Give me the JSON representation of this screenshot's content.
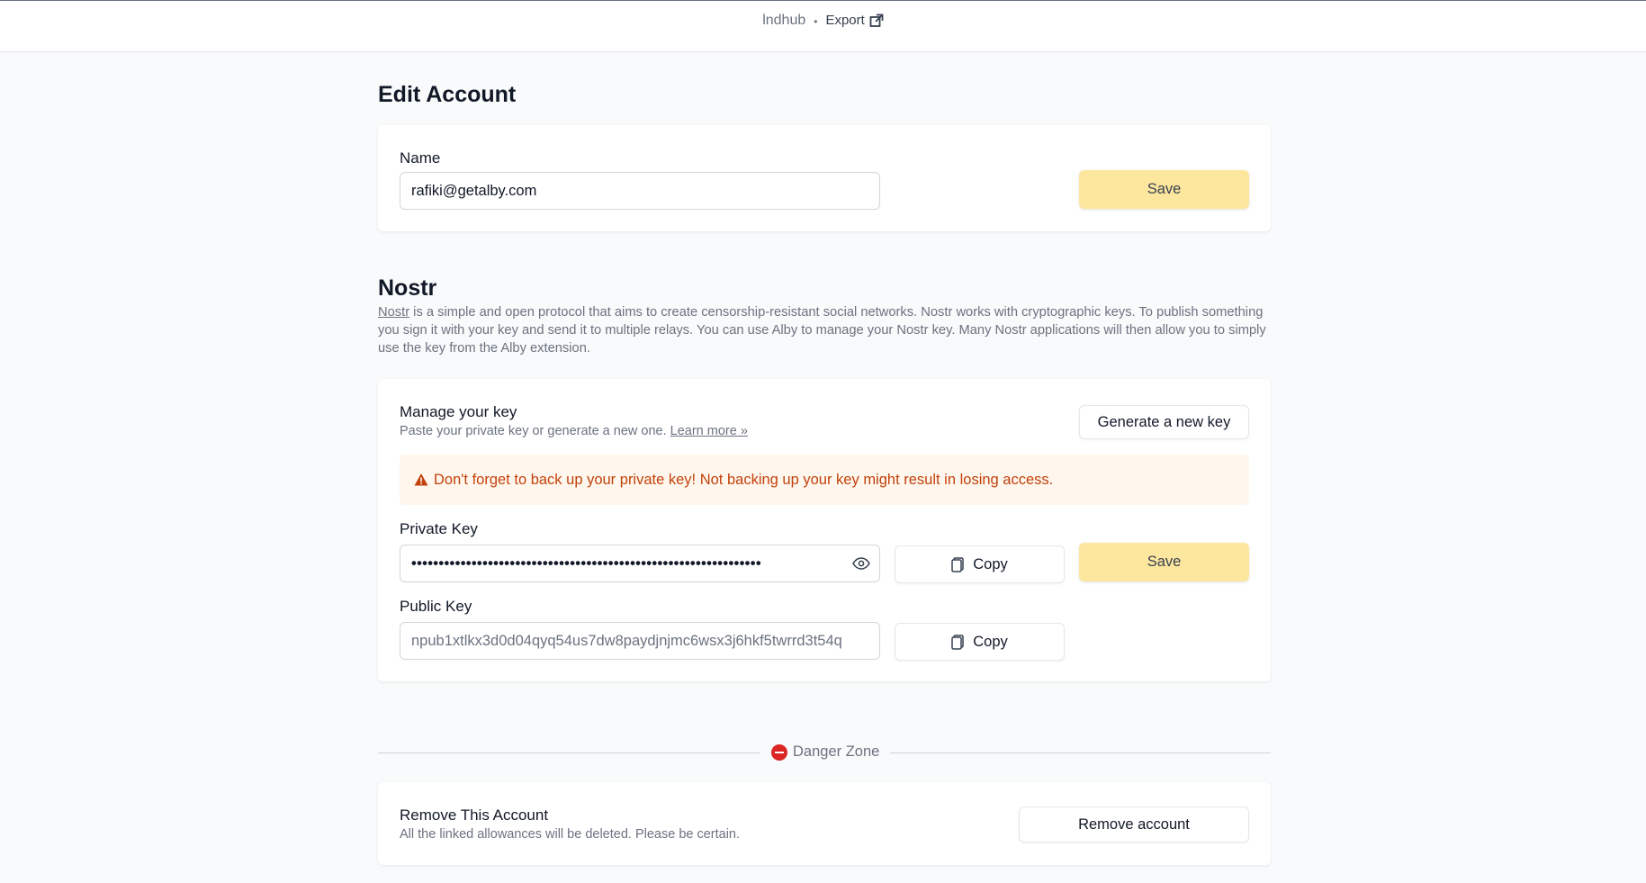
{
  "topbar": {
    "site": "lndhub",
    "separator": "•",
    "export_label": "Export"
  },
  "page_title": "Edit Account",
  "account": {
    "name_label": "Name",
    "name_value": "rafiki@getalby.com",
    "save_label": "Save"
  },
  "nostr": {
    "title": "Nostr",
    "desc_link": "Nostr",
    "desc_rest": " is a simple and open protocol that aims to create censorship-resistant social networks. Nostr works with cryptographic keys. To publish something you sign it with your key and send it to multiple relays. You can use Alby to manage your Nostr key. Many Nostr applications will then allow you to simply use the key from the Alby extension.",
    "manage_title": "Manage your key",
    "manage_sub": "Paste your private key or generate a new one.",
    "learn_more": "Learn more »",
    "generate_label": "Generate a new key",
    "warning": "Don't forget to back up your private key! Not backing up your key might result in losing access.",
    "private_key_label": "Private Key",
    "private_key_value": "••••••••••••••••••••••••••••••••••••••••••••••••••••••••••••••••",
    "copy_label": "Copy",
    "save_label": "Save",
    "public_key_label": "Public Key",
    "public_key_value": "npub1xtlkx3d0d04qyq54us7dw8paydjnjmc6wsx3j6hkf5twrrd3t54q"
  },
  "danger": {
    "label": "Danger Zone",
    "remove_title": "Remove This Account",
    "remove_sub": "All the linked allowances will be deleted. Please be certain.",
    "remove_button": "Remove account"
  },
  "colors": {
    "primary_button": "#fde69d",
    "warning_bg": "#fff7ed",
    "warning_text": "#c2410c",
    "danger_icon": "#dc2626"
  }
}
